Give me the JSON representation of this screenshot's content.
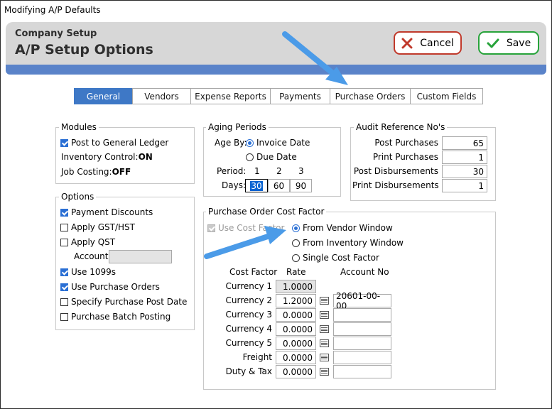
{
  "window": {
    "title": "Modifying A/P Defaults"
  },
  "header": {
    "subtitle": "Company Setup",
    "title": "A/P Setup Options"
  },
  "buttons": {
    "cancel": "Cancel",
    "save": "Save"
  },
  "colors": {
    "accent": "#3e78c6",
    "header_band": "#5a83c9",
    "cancel_border": "#c0392b",
    "save_border": "#27a33a",
    "annotation_arrow": "#4b9be8"
  },
  "tabs": [
    {
      "label": "General",
      "active": true
    },
    {
      "label": "Vendors",
      "active": false
    },
    {
      "label": "Expense Reports",
      "active": false
    },
    {
      "label": "Payments",
      "active": false
    },
    {
      "label": "Purchase Orders",
      "active": false
    },
    {
      "label": "Custom Fields",
      "active": false
    }
  ],
  "modules": {
    "legend": "Modules",
    "post_gl": {
      "label": "Post to General Ledger",
      "checked": true
    },
    "inventory_label": "Inventory Control: ",
    "inventory_value": "ON",
    "job_label": "Job Costing: ",
    "job_value": "OFF"
  },
  "options": {
    "legend": "Options",
    "items": [
      {
        "label": "Payment Discounts",
        "checked": true
      },
      {
        "label": "Apply GST/HST",
        "checked": false
      },
      {
        "label": "Apply QST",
        "checked": false
      },
      {
        "label": "Use 1099s",
        "checked": true
      },
      {
        "label": "Use Purchase Orders",
        "checked": true
      },
      {
        "label": "Specify Purchase Post Date",
        "checked": false
      },
      {
        "label": "Purchase Batch Posting",
        "checked": false
      }
    ],
    "account_label": "Account",
    "account_value": ""
  },
  "aging": {
    "legend": "Aging Periods",
    "age_by_label": "Age By:",
    "invoice_date": "Invoice Date",
    "due_date": "Due Date",
    "selected": "Invoice Date",
    "period_label": "Period:",
    "periods": [
      "1",
      "2",
      "3"
    ],
    "days_label": "Days:",
    "days": [
      "30",
      "60",
      "90"
    ]
  },
  "audit": {
    "legend": "Audit Reference No's",
    "rows": [
      {
        "label": "Post Purchases",
        "value": "65"
      },
      {
        "label": "Print Purchases",
        "value": "1"
      },
      {
        "label": "Post Disbursements",
        "value": "30"
      },
      {
        "label": "Print Disbursements",
        "value": "1"
      }
    ]
  },
  "po_cost": {
    "legend": "Purchase Order Cost Factor",
    "use_cost_factor": {
      "label": "Use Cost Factor",
      "checked": true,
      "disabled": true
    },
    "radios": [
      {
        "label": "From Vendor Window",
        "selected": true
      },
      {
        "label": "From Inventory Window",
        "selected": false
      },
      {
        "label": "Single Cost Factor",
        "selected": false
      }
    ],
    "col_cost_factor": "Cost Factor",
    "col_rate": "Rate",
    "col_account": "Account No",
    "rows": [
      {
        "label": "Currency 1",
        "rate": "1.0000",
        "account": ""
      },
      {
        "label": "Currency 2",
        "rate": "1.2000",
        "account": "20601-00-00"
      },
      {
        "label": "Currency 3",
        "rate": "0.0000",
        "account": ""
      },
      {
        "label": "Currency 4",
        "rate": "0.0000",
        "account": ""
      },
      {
        "label": "Currency 5",
        "rate": "0.0000",
        "account": ""
      },
      {
        "label": "Freight",
        "rate": "0.0000",
        "account": ""
      },
      {
        "label": "Duty & Tax",
        "rate": "0.0000",
        "account": ""
      }
    ]
  }
}
